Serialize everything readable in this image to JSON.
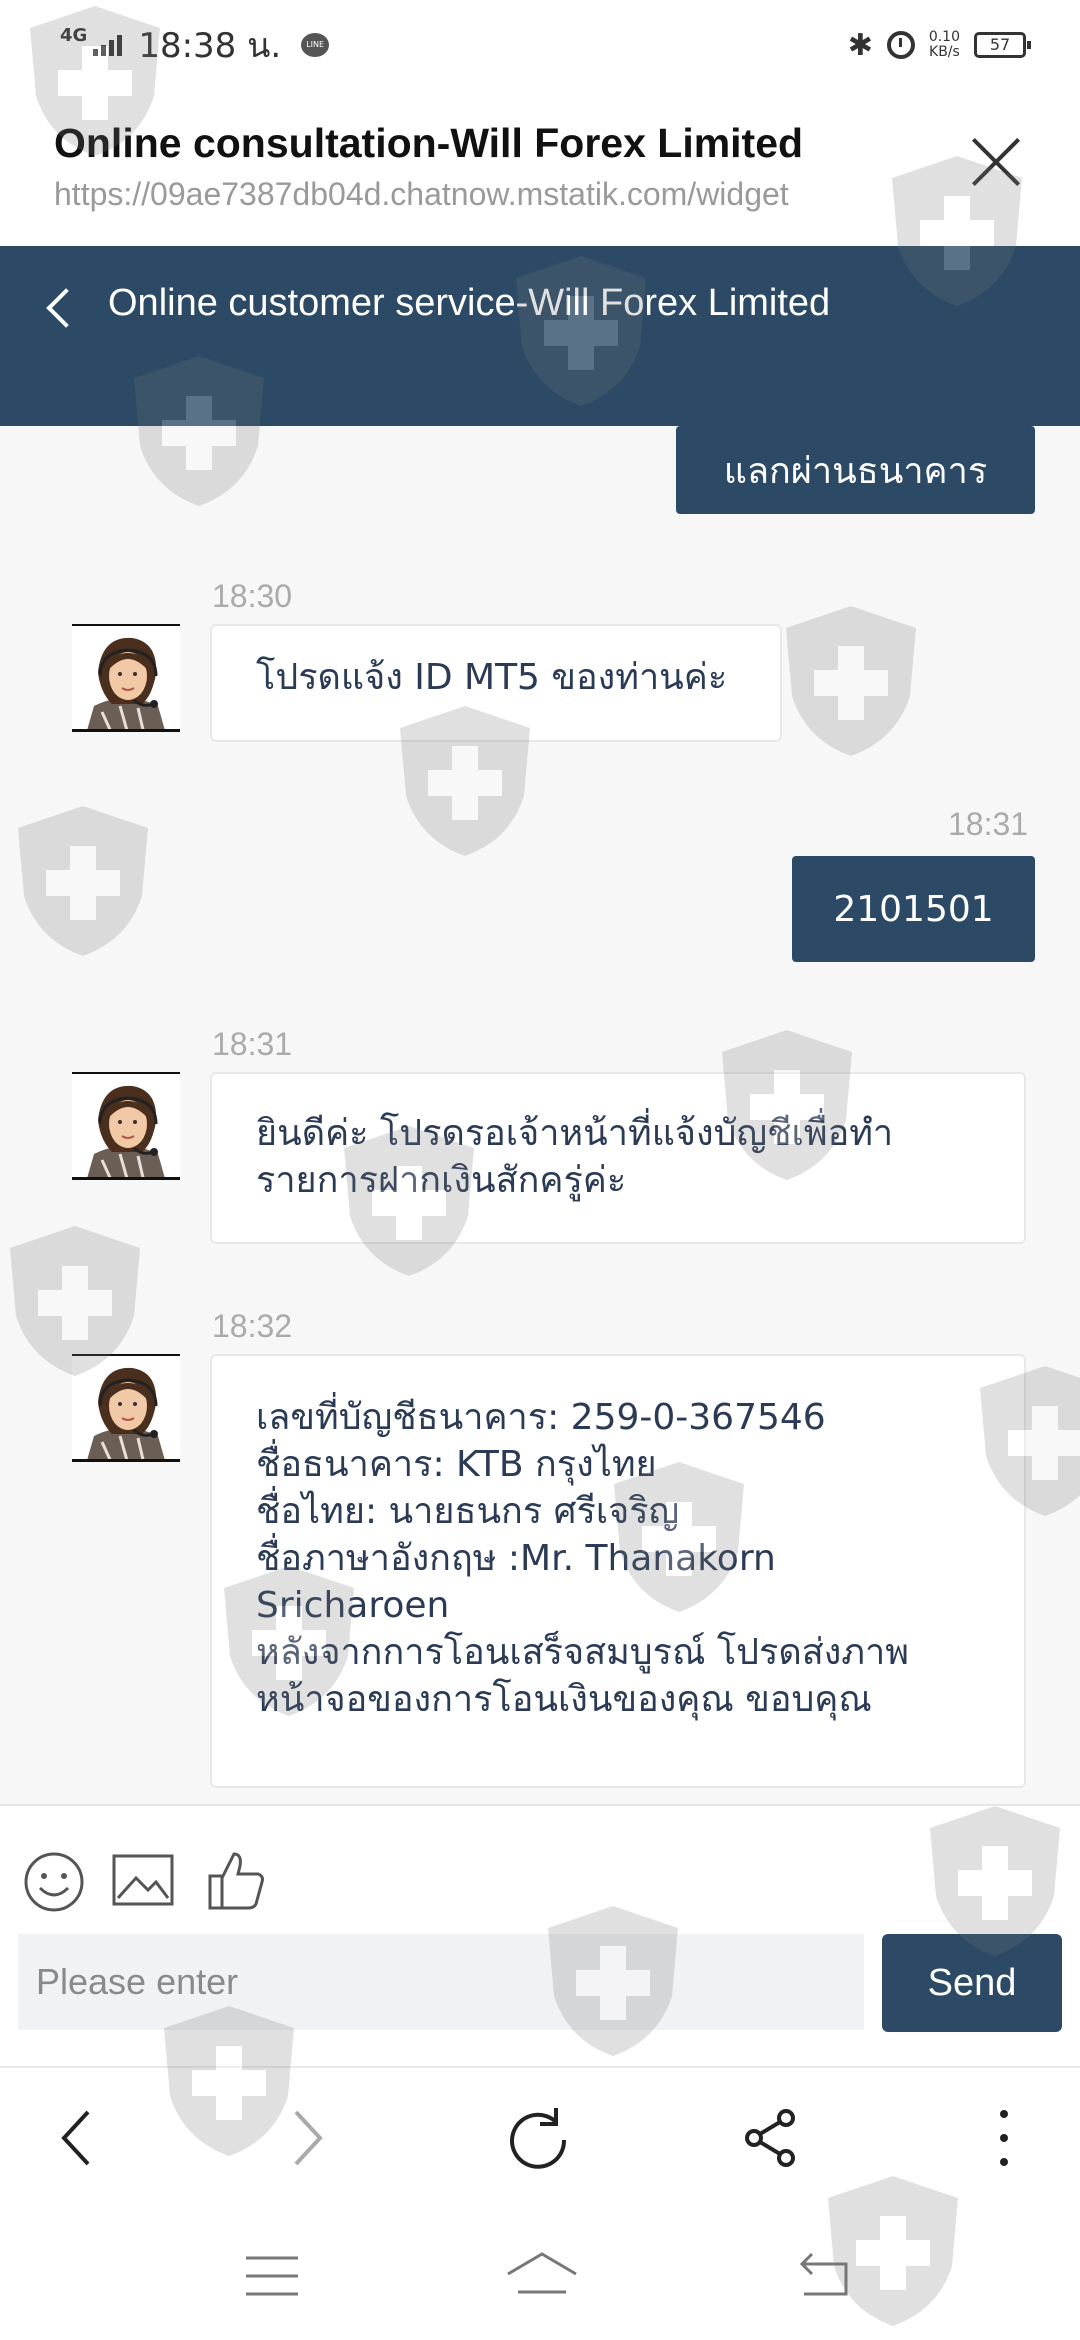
{
  "status_bar": {
    "network": "4G",
    "time": "18:38 น.",
    "speed_value": "0.10",
    "speed_unit": "KB/s",
    "battery": "57"
  },
  "page": {
    "title": "Online consultation-Will Forex Limited",
    "url": "https://09ae7387db04d.chatnow.mstatik.com/widget"
  },
  "chat": {
    "title": "Online customer service-Will Forex Limited"
  },
  "messages": {
    "m0_text": "แลกผ่านธนาคาร",
    "m1_time": "18:30",
    "m1_text": "โปรดแจ้ง ID MT5 ของท่านค่ะ",
    "m2_time": "18:31",
    "m2_text": "2101501",
    "m3_time": "18:31",
    "m3_lines": [
      "ยินดีค่ะ โปรดรอเจ้าหน้าที่แจ้งบัญชีเพื่อทำ",
      "รายการฝากเงินสักครู่ค่ะ"
    ],
    "m4_time": "18:32",
    "m4_lines": [
      "เลขที่บัญชีธนาคาร: 259-0-367546",
      "ชื่อธนาคาร: KTB กรุงไทย",
      "ชื่อไทย: นายธนกร ศรีเจริญ",
      "ชื่อภาษาอังกฤษ :Mr. Thanakorn",
      "Sricharoen",
      "หลังจากการโอนเสร็จสมบูรณ์ โปรดส่งภาพ",
      "หน้าจอของการโอนเงินของคุณ ขอบคุณ"
    ]
  },
  "composer": {
    "placeholder": "Please enter",
    "send_label": "Send",
    "tools": [
      "emoji-icon",
      "image-icon",
      "thumbs-up-icon"
    ]
  },
  "browser_nav": [
    "back-icon",
    "forward-icon",
    "reload-icon",
    "share-icon",
    "more-icon"
  ],
  "system_nav": [
    "menu-icon",
    "home-icon",
    "back-icon"
  ],
  "colors": {
    "brand": "#2c4a66",
    "chat_background": "#f7f7f7",
    "incoming_text": "#2b3a55"
  }
}
